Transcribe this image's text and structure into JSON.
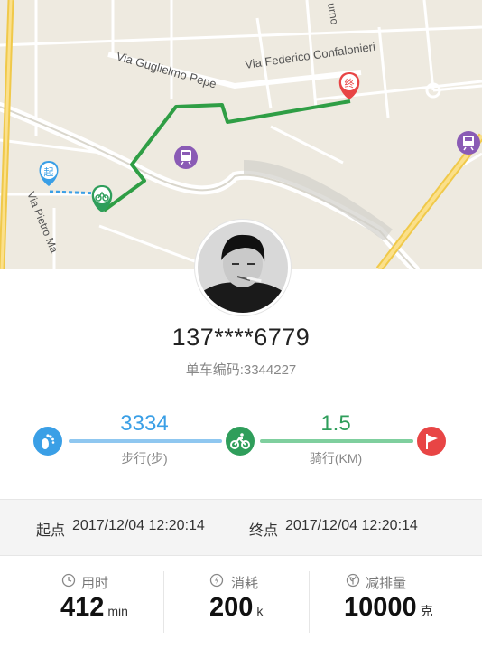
{
  "map": {
    "streets": [
      "Via Federico Confalonieri",
      "Via Guglielmo Pepe",
      "Via Pietro Ma",
      "urno"
    ],
    "start_marker": "起",
    "end_marker": "终"
  },
  "user": {
    "phone": "137****6779",
    "bike_label": "单车编码:3344227"
  },
  "stats": {
    "walk_value": "3334",
    "walk_label": "步行(步)",
    "ride_value": "1.5",
    "ride_label": "骑行(KM)",
    "walk_color": "#3a9fe6",
    "ride_color": "#2f9e5b",
    "end_color": "#e84545"
  },
  "times": {
    "start_label": "起点",
    "start_time": "2017/12/04   12:20:14",
    "end_label": "终点",
    "end_time": "2017/12/04   12:20:14"
  },
  "metrics": [
    {
      "icon": "clock-icon",
      "label": "用时",
      "value": "412",
      "unit": "min"
    },
    {
      "icon": "energy-icon",
      "label": "消耗",
      "value": "200",
      "unit": "k"
    },
    {
      "icon": "leaf-icon",
      "label": "减排量",
      "value": "10000",
      "unit": "克"
    }
  ]
}
